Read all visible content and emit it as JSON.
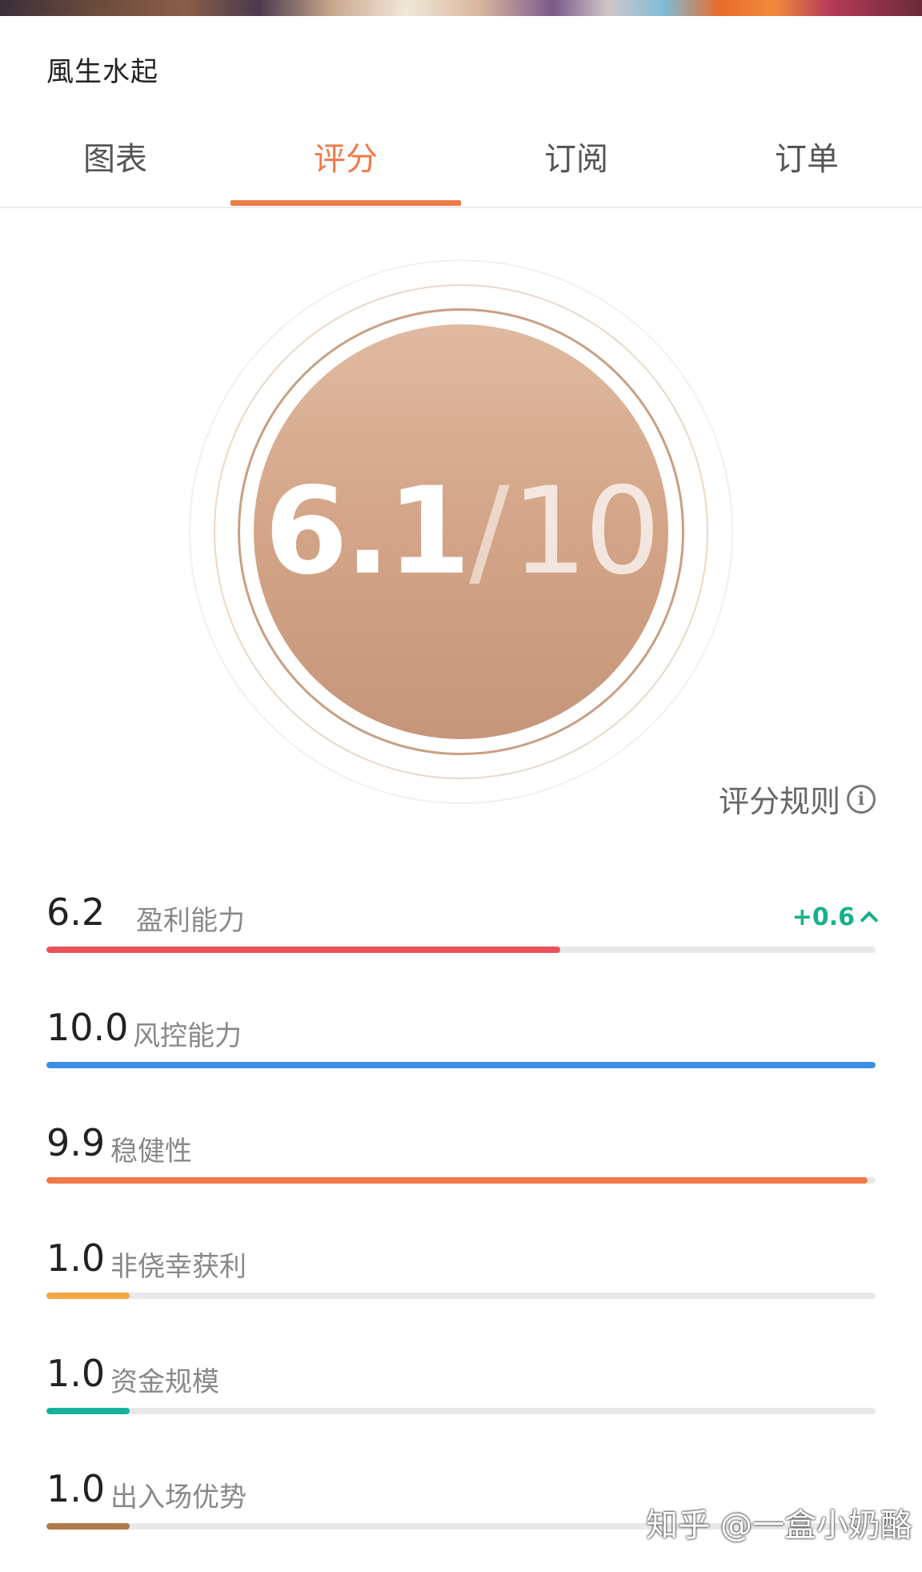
{
  "trader_name": "風生水起",
  "tabs": [
    {
      "label": "图表",
      "active": false
    },
    {
      "label": "评分",
      "active": true
    },
    {
      "label": "订阅",
      "active": false
    },
    {
      "label": "订单",
      "active": false
    }
  ],
  "score": {
    "value": "6.1",
    "slash": "/",
    "max": "10"
  },
  "rules_link": "评分规则",
  "metrics": [
    {
      "score": "6.2",
      "label": "盈利能力",
      "change": "+0.6",
      "fraction": 0.62,
      "color": "#e8505b"
    },
    {
      "score": "10.0",
      "label": "风控能力",
      "fraction": 1.0,
      "color": "#3b8ee8"
    },
    {
      "score": "9.9",
      "label": "稳健性",
      "fraction": 0.99,
      "color": "#f07a48"
    },
    {
      "score": "1.0",
      "label": "非侥幸获利",
      "fraction": 0.1,
      "color": "#f3a545"
    },
    {
      "score": "1.0",
      "label": "资金规模",
      "fraction": 0.1,
      "color": "#14b39a"
    },
    {
      "score": "1.0",
      "label": "出入场优势",
      "fraction": 0.1,
      "color": "#b07a4a"
    }
  ],
  "watermark": "知乎 @一盒小奶酪"
}
